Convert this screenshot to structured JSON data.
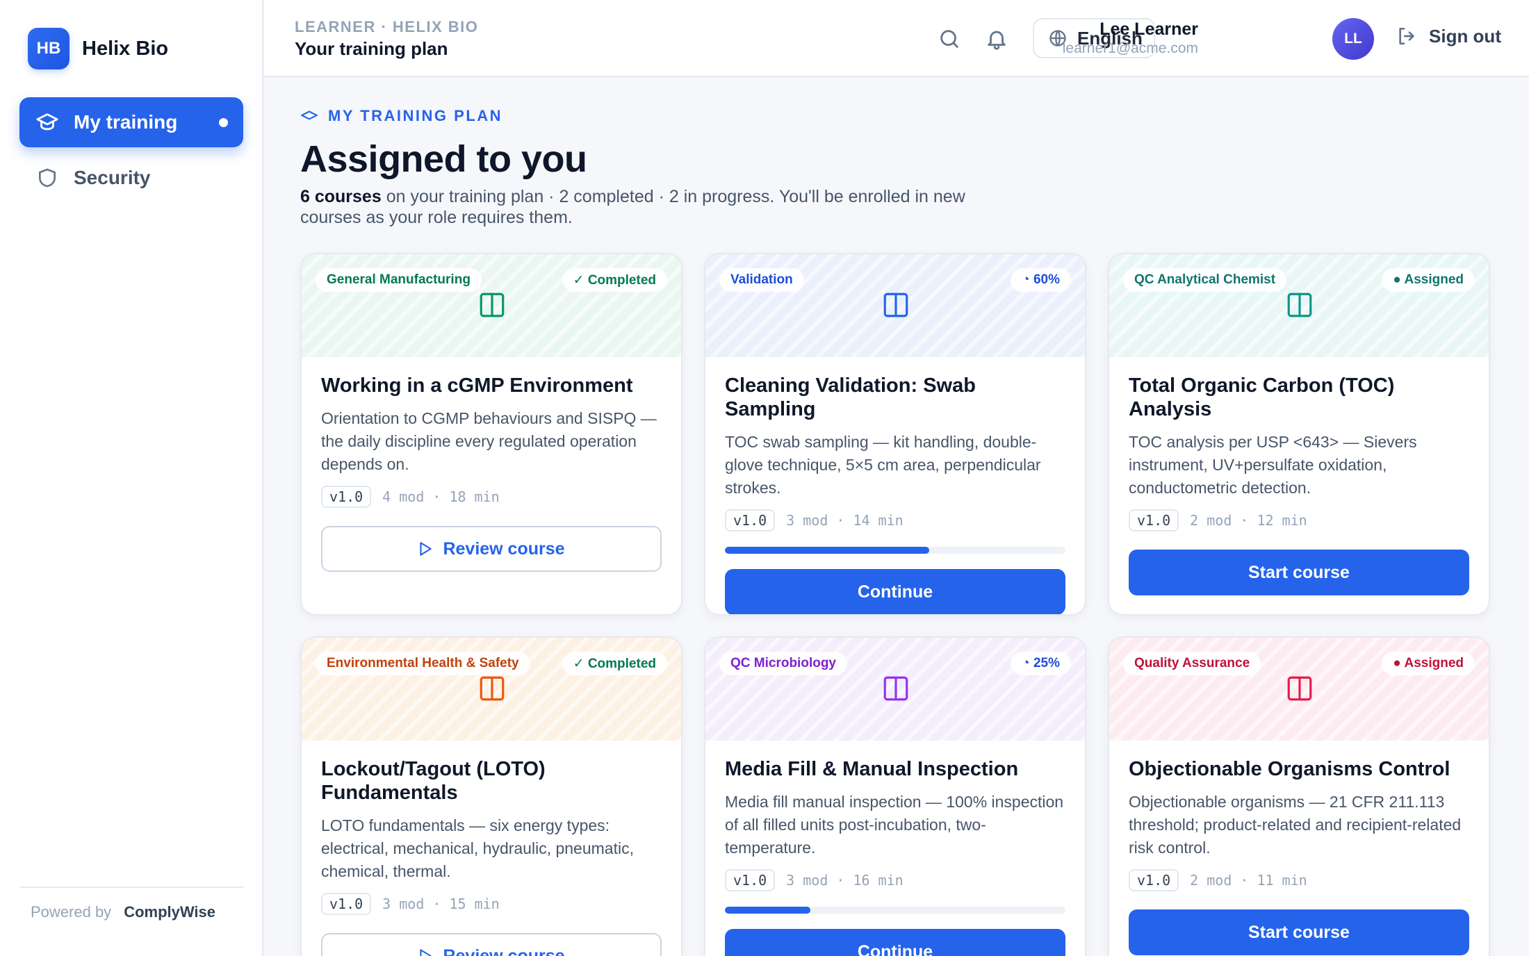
{
  "brand": {
    "logo_text": "HB",
    "name": "Helix Bio"
  },
  "sidebar": {
    "items": [
      {
        "label": "My training",
        "icon": "graduation-cap-icon",
        "active": true
      },
      {
        "label": "Security",
        "icon": "shield-icon",
        "active": false
      }
    ],
    "footer": {
      "prefix": "Powered by",
      "name": "ComplyWise"
    }
  },
  "header": {
    "breadcrumb": "LEARNER · HELIX BIO",
    "title": "Your training plan",
    "language": "English",
    "user": {
      "name": "Lee Learner",
      "email": "learner1@acme.com",
      "initials": "LL"
    },
    "sign_out": "Sign out"
  },
  "main": {
    "eyebrow": "MY TRAINING PLAN",
    "title": "Assigned to you",
    "summary_count": "6 courses",
    "summary_rest": " on your training plan · 2 completed · 2 in progress. You'll be enrolled in new courses as your role requires them."
  },
  "colors": {
    "accent": "#2563eb",
    "completed": "#047857",
    "in_progress": "#1d4ed8",
    "assigned_teal": "#0f766e",
    "assigned_red": "#be123c"
  },
  "courses": [
    {
      "category": "General Manufacturing",
      "status": "✓ Completed",
      "title": "Working in a cGMP Environment",
      "description": "Orientation to CGMP behaviours and SISPQ — the daily discipline every regulated operation depends on.",
      "version": "v1.0",
      "modules": "4 mod",
      "duration": "18 min",
      "progress": null,
      "button": "Review course"
    },
    {
      "category": "Validation",
      "status": "◔ 60%",
      "title": "Cleaning Validation: Swab Sampling",
      "description": "TOC swab sampling — kit handling, double-glove technique, 5×5 cm area, perpendicular strokes.",
      "version": "v1.0",
      "modules": "3 mod",
      "duration": "14 min",
      "progress": 60,
      "button": "Continue"
    },
    {
      "category": "QC Analytical Chemist",
      "status": "● Assigned",
      "title": "Total Organic Carbon (TOC) Analysis",
      "description": "TOC analysis per USP <643> — Sievers instrument, UV+persulfate oxidation, conductometric detection.",
      "version": "v1.0",
      "modules": "2 mod",
      "duration": "12 min",
      "progress": null,
      "button": "Start course"
    },
    {
      "category": "Environmental Health & Safety",
      "status": "✓ Completed",
      "title": "Lockout/Tagout (LOTO) Fundamentals",
      "description": "LOTO fundamentals — six energy types: electrical, mechanical, hydraulic, pneumatic, chemical, thermal.",
      "version": "v1.0",
      "modules": "3 mod",
      "duration": "15 min",
      "progress": null,
      "button": "Review course"
    },
    {
      "category": "QC Microbiology",
      "status": "◔ 25%",
      "title": "Media Fill & Manual Inspection",
      "description": "Media fill manual inspection — 100% inspection of all filled units post-incubation, two-temperature.",
      "version": "v1.0",
      "modules": "3 mod",
      "duration": "16 min",
      "progress": 25,
      "button": "Continue"
    },
    {
      "category": "Quality Assurance",
      "status": "● Assigned",
      "title": "Objectionable Organisms Control",
      "description": "Objectionable organisms — 21 CFR 211.113 threshold; product-related and recipient-related risk control.",
      "version": "v1.0",
      "modules": "2 mod",
      "duration": "11 min",
      "progress": null,
      "button": "Start course"
    }
  ]
}
